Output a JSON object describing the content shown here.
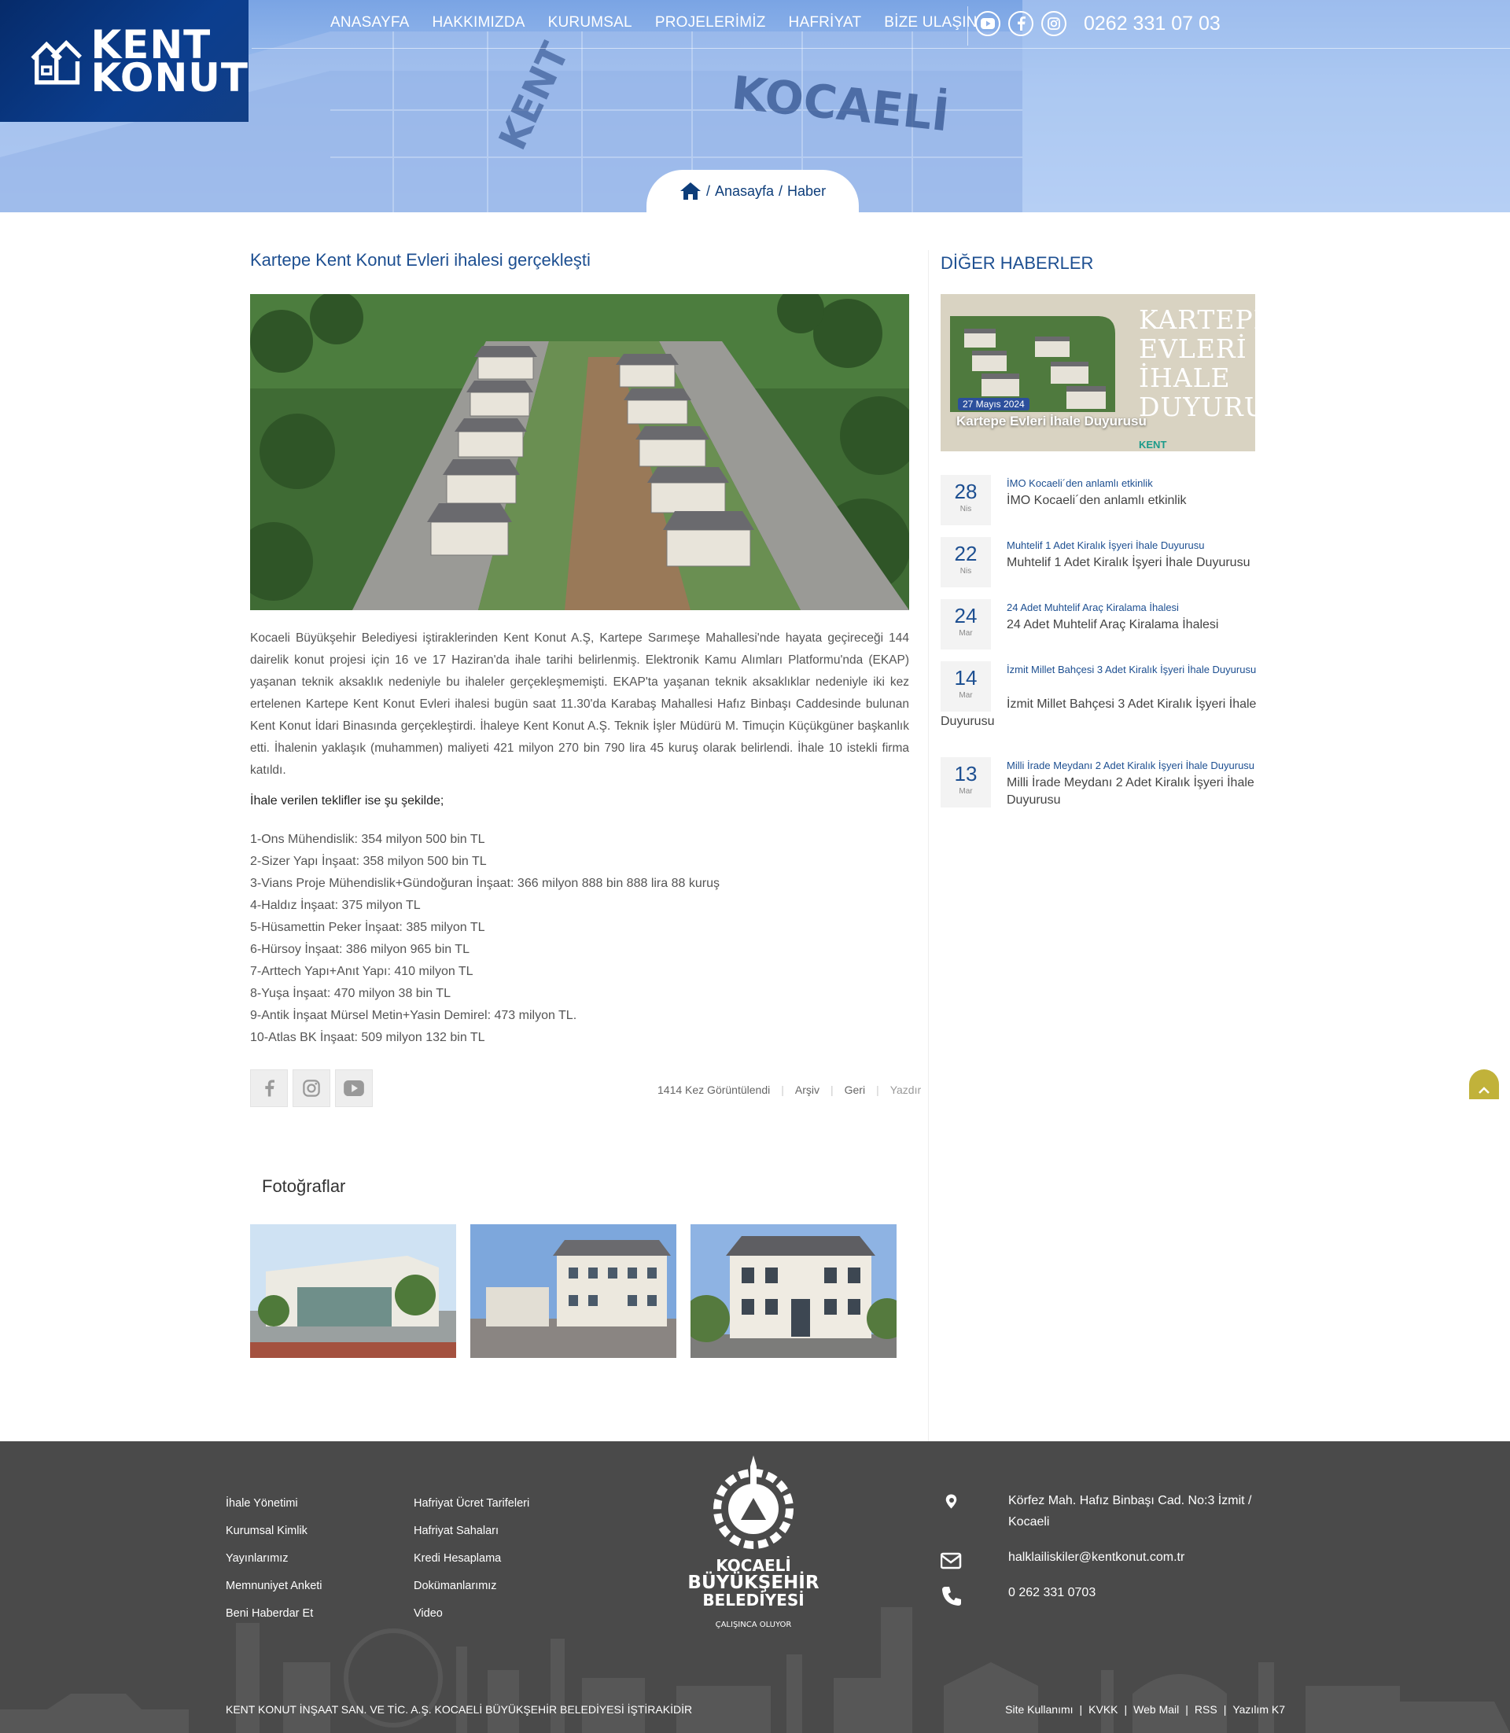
{
  "header": {
    "logo_line1": "KENT",
    "logo_line2": "KONUT",
    "nav": [
      "ANASAYFA",
      "HAKKIMIZDA",
      "KURUMSAL",
      "PROJELERİMİZ",
      "HAFRİYAT",
      "BİZE ULAŞIN"
    ],
    "phone": "0262 331 07 03",
    "socials": [
      "youtube-icon",
      "facebook-icon",
      "instagram-icon"
    ]
  },
  "breadcrumb": {
    "home": "Anasayfa",
    "sep": "/",
    "current": "Haber"
  },
  "article": {
    "title": "Kartepe Kent Konut Evleri ihalesi gerçekleşti",
    "body": "Kocaeli Büyükşehir Belediyesi iştiraklerinden Kent Konut A.Ş, Kartepe Sarımeşe Mahallesi'nde hayata geçireceği 144 dairelik konut projesi için 16 ve 17 Haziran'da ihale tarihi belirlenmiş. Elektronik Kamu Alımları Platformu'nda (EKAP) yaşanan teknik aksaklık nedeniyle bu ihaleler gerçekleşmemişti. EKAP'ta yaşanan teknik aksaklıklar nedeniyle iki kez ertelenen Kartepe Kent Konut Evleri ihalesi bugün saat 11.30'da Karabaş Mahallesi Hafız Binbaşı Caddesinde bulunan Kent Konut İdari Binasında gerçekleştirdi. İhaleye Kent Konut A.Ş. Teknik İşler Müdürü M. Timuçin Küçükgüner başkanlık etti. İhalenin yaklaşık (muhammen) maliyeti 421 milyon 270 bin 790 lira 45 kuruş olarak belirlendi. İhale 10 istekli firma katıldı.",
    "bids_heading": "İhale verilen teklifler ise şu şekilde;",
    "bids": [
      "1-Ons Mühendislik: 354 milyon 500 bin TL",
      "2-Sizer Yapı İnşaat: 358 milyon 500 bin TL",
      "3-Vians Proje Mühendislik+Gündoğuran İnşaat: 366 milyon 888 bin 888 lira 88 kuruş",
      "4-Haldız İnşaat:  375 milyon TL",
      "5-Hüsamettin Peker İnşaat: 385 milyon TL",
      "6-Hürsoy İnşaat:  386 milyon 965 bin TL",
      "7-Arttech Yapı+Anıt Yapı: 410 milyon TL",
      "8-Yuşa İnşaat:  470 milyon 38 bin TL",
      "9-Antik İnşaat Mürsel Metin+Yasin Demirel:  473 milyon TL.",
      "10-Atlas BK İnşaat: 509 milyon 132 bin TL"
    ],
    "views": "1414 Kez Görüntülendi",
    "archive": "Arşiv",
    "back": "Geri",
    "print": "Yazdır",
    "photos_heading": "Fotoğraflar"
  },
  "sidebar": {
    "heading": "DİĞER HABERLER",
    "featured": {
      "caption": "Kartepe Evleri İhale Duyurusu",
      "poster_l1": "KARTEPE",
      "poster_l2": "EVLERİ",
      "poster_l3": "İHALE",
      "poster_l4": "DUYURUSU",
      "poster_date": "27 Mayıs 2024",
      "poster_brand": "KENT"
    },
    "items": [
      {
        "day": "28",
        "month": "Nis",
        "small": "İMO Kocaeli´den anlamlı etkinlik",
        "title": "İMO Kocaeli´den anlamlı etkinlik"
      },
      {
        "day": "22",
        "month": "Nis",
        "small": "Muhtelif 1 Adet Kiralık İşyeri İhale Duyurusu",
        "title": "Muhtelif 1 Adet Kiralık İşyeri İhale Duyurusu"
      },
      {
        "day": "24",
        "month": "Mar",
        "small": "24 Adet Muhtelif Araç Kiralama İhalesi",
        "title": "24 Adet Muhtelif Araç Kiralama İhalesi"
      },
      {
        "day": "14",
        "month": "Mar",
        "small": "İzmit Millet Bahçesi 3 Adet Kiralık İşyeri İhale Duyurusu",
        "title": "İzmit Millet Bahçesi 3 Adet Kiralık İşyeri İhale",
        "title_wrap": "Duyurusu"
      },
      {
        "day": "13",
        "month": "Mar",
        "small": "Milli İrade Meydanı 2 Adet Kiralık İşyeri İhale Duyurusu",
        "title": "Milli İrade Meydanı 2 Adet Kiralık İşyeri İhale Duyurusu"
      }
    ]
  },
  "footer": {
    "col1": [
      "İhale Yönetimi",
      "Kurumsal Kimlik",
      "Yayınlarımız",
      "Memnuniyet Anketi",
      "Beni Haberdar Et"
    ],
    "col2": [
      "Hafriyat Ücret Tarifeleri",
      "Hafriyat Sahaları",
      "Kredi Hesaplama",
      "Dokümanlarımız",
      "Video"
    ],
    "kbb_l1": "KOCAELİ",
    "kbb_l2": "BÜYÜKŞEHİR",
    "kbb_l3": "BELEDİYESİ",
    "kbb_slogan": "ÇALIŞINCA OLUYOR",
    "address": "Körfez Mah. Hafız Binbaşı Cad. No:3 İzmit / Kocaeli",
    "email": "halklailiskiler@kentkonut.com.tr",
    "phone": "0 262 331 0703",
    "copyright": "KENT KONUT İNŞAAT SAN. VE TİC. A.Ş. KOCAELİ BÜYÜKŞEHİR BELEDİYESİ İŞTİRAKİDİR",
    "links": [
      "Site Kullanımı",
      "KVKK",
      "Web Mail",
      "RSS",
      "Yazılım K7"
    ]
  }
}
